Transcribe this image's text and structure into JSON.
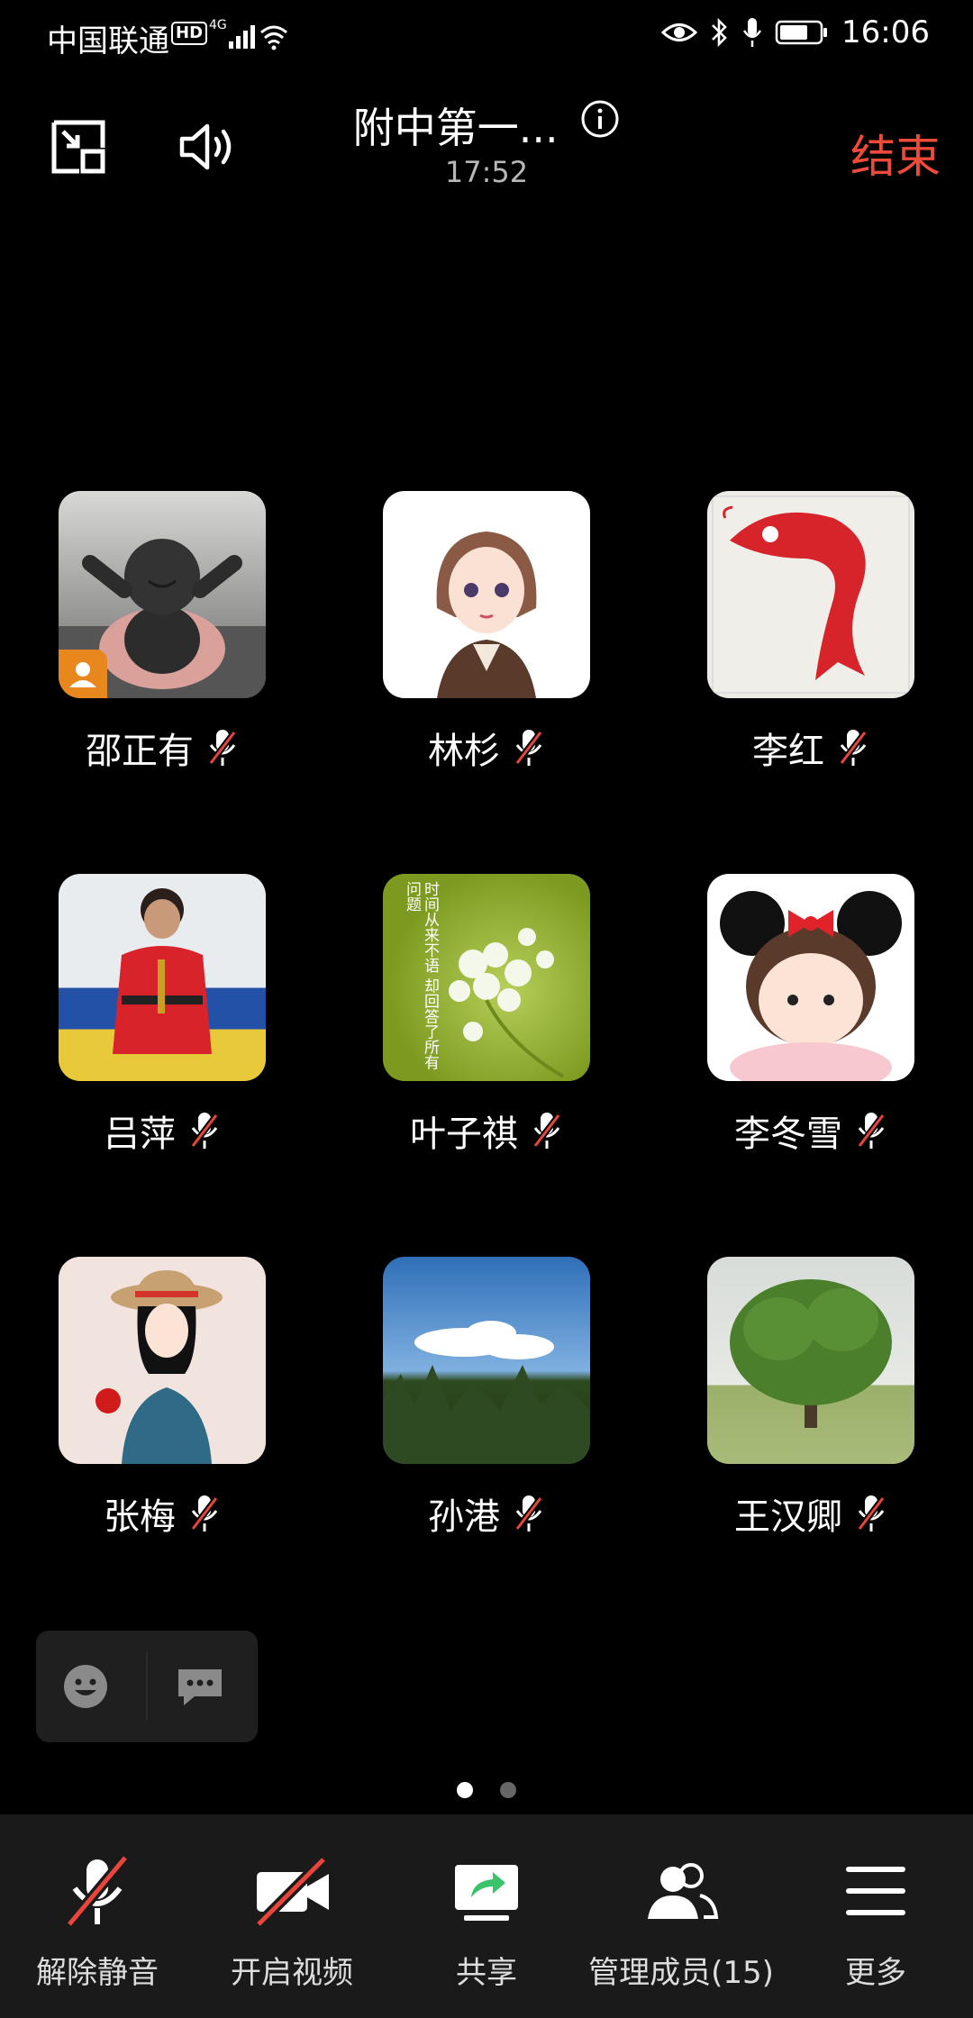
{
  "status_bar": {
    "carrier": "中国联通",
    "hd_badge": "HD",
    "network": "4G",
    "time": "16:06"
  },
  "header": {
    "title": "附中第一...",
    "duration": "17:52",
    "end_label": "结束"
  },
  "participants": [
    {
      "name": "邵正有",
      "host": true,
      "avatar": "buddha-figurine"
    },
    {
      "name": "林杉",
      "avatar": "cartoon-girl"
    },
    {
      "name": "李红",
      "avatar": "red-koi-fish"
    },
    {
      "name": "吕萍",
      "avatar": "boy-in-red"
    },
    {
      "name": "叶子祺",
      "avatar": "white-flowers",
      "avatar_text": "时间从来不语 却回答了所有问题"
    },
    {
      "name": "李冬雪",
      "avatar": "minnie-girl"
    },
    {
      "name": "张梅",
      "avatar": "girl-with-apple"
    },
    {
      "name": "孙港",
      "avatar": "sky-trees"
    },
    {
      "name": "王汉卿",
      "avatar": "big-tree"
    }
  ],
  "page_indicator": {
    "total": 2,
    "current": 1
  },
  "toolbar": {
    "unmute": "解除静音",
    "video": "开启视频",
    "share": "共享",
    "members": "管理成员(15)",
    "more": "更多"
  },
  "colors": {
    "end": "#ee4b3a",
    "mute_slash": "#e8453c",
    "toolbar_bg": "#1a1a1a"
  }
}
